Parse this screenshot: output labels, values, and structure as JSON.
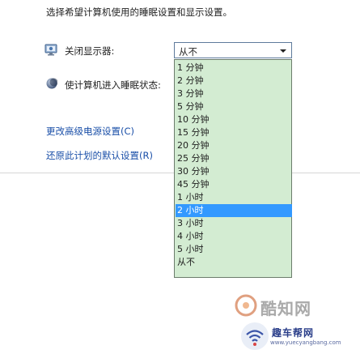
{
  "intro": "选择希望计算机使用的睡眠设置和显示设置。",
  "display_off": {
    "label": "关闭显示器:",
    "selected": "从不"
  },
  "sleep": {
    "label": "使计算机进入睡眠状态:"
  },
  "dropdown": {
    "options": [
      "1 分钟",
      "2 分钟",
      "3 分钟",
      "5 分钟",
      "10 分钟",
      "15 分钟",
      "20 分钟",
      "25 分钟",
      "30 分钟",
      "45 分钟",
      "1 小时",
      "2 小时",
      "3 小时",
      "4 小时",
      "5 小时",
      "从不"
    ],
    "highlighted": "2 小时"
  },
  "links": {
    "advanced": "更改高级电源设置(C)",
    "restore": "还原此计划的默认设置(R)"
  },
  "watermarks": {
    "brand": "酷知网",
    "site_name": "趣车帮网",
    "site_url": "www.yuecyangbang.com"
  },
  "colors": {
    "dropdown_bg": "#d3ecd2",
    "highlight": "#3399ff",
    "link": "#1a4fa8"
  }
}
